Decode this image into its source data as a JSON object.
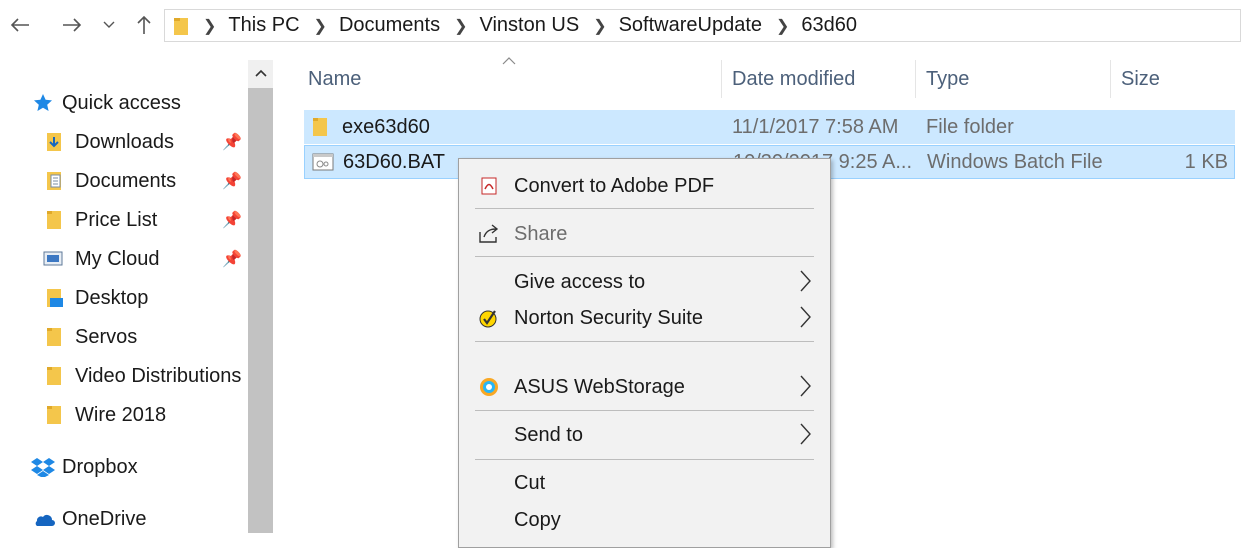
{
  "nav": {
    "back_icon": "arrow-left-icon",
    "forward_icon": "arrow-right-icon",
    "recent_icon": "chevron-down-icon",
    "up_icon": "arrow-up-icon"
  },
  "breadcrumb": [
    "This PC",
    "Documents",
    "Vinston US",
    "SoftwareUpdate",
    "63d60"
  ],
  "sidebar": {
    "quick_access": "Quick access",
    "items": [
      {
        "label": "Downloads",
        "pinned": true
      },
      {
        "label": "Documents",
        "pinned": true
      },
      {
        "label": "Price List",
        "pinned": true
      },
      {
        "label": "My Cloud",
        "pinned": true
      },
      {
        "label": "Desktop",
        "pinned": false
      },
      {
        "label": "Servos",
        "pinned": false
      },
      {
        "label": "Video Distributions",
        "pinned": false
      },
      {
        "label": "Wire 2018",
        "pinned": false
      }
    ],
    "dropbox": "Dropbox",
    "onedrive": "OneDrive"
  },
  "columns": {
    "name": "Name",
    "date": "Date modified",
    "type": "Type",
    "size": "Size"
  },
  "files": [
    {
      "name": "exe63d60",
      "date": "11/1/2017 7:58 AM",
      "type": "File folder",
      "size": ""
    },
    {
      "name": "63D60.BAT",
      "date": "10/30/2017 9:25 A...",
      "type": "Windows Batch File",
      "size": "1 KB"
    }
  ],
  "context_menu": {
    "convert_pdf": "Convert to Adobe PDF",
    "share": "Share",
    "give_access": "Give access to",
    "norton": "Norton Security Suite",
    "asus": "ASUS WebStorage",
    "send_to": "Send to",
    "cut": "Cut",
    "copy": "Copy"
  },
  "colors": {
    "selection": "#cce8ff",
    "selection_border": "#99d1ff",
    "header_text": "#4c607a",
    "folder": "#f4c64b",
    "quick_access_star": "#1e88e5"
  }
}
